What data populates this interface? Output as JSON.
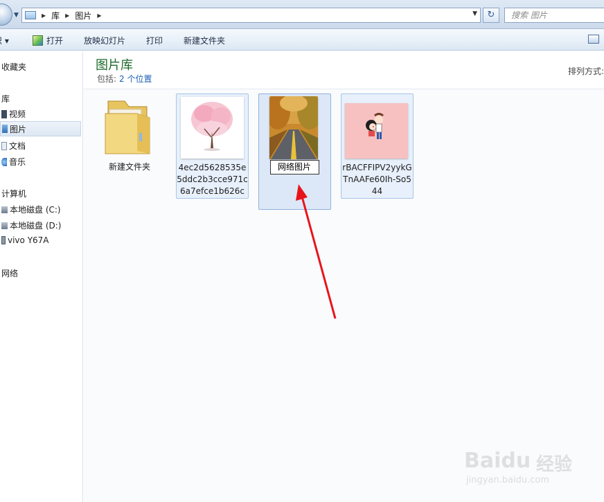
{
  "address": {
    "breadcrumbs": [
      "库",
      "图片"
    ],
    "search_placeholder": "搜索 图片"
  },
  "toolbar": {
    "organize_label": "织 ▾",
    "open_label": "打开",
    "slideshow_label": "放映幻灯片",
    "print_label": "打印",
    "new_folder_label": "新建文件夹"
  },
  "nav": {
    "favorites": "收藏夹",
    "libraries": "库",
    "items": [
      {
        "label": "视频",
        "icon": "video-icon"
      },
      {
        "label": "图片",
        "icon": "pictures-icon",
        "selected": true
      },
      {
        "label": "文档",
        "icon": "document-icon"
      },
      {
        "label": "音乐",
        "icon": "music-icon"
      }
    ],
    "computer": "计算机",
    "drives": [
      {
        "label": "本地磁盘 (C:)",
        "icon": "drive-icon"
      },
      {
        "label": "本地磁盘 (D:)",
        "icon": "drive-icon"
      },
      {
        "label": "vivo Y67A",
        "icon": "phone-icon"
      }
    ],
    "network": "网络"
  },
  "library": {
    "title": "图片库",
    "includes_label": "包括:",
    "locations_link": "2 个位置",
    "arrange_label": "排列方式:"
  },
  "files": [
    {
      "name": "新建文件夹",
      "type": "folder"
    },
    {
      "name": "4ec2d5628535e5ddc2b3cce971c6a7efce1b626c",
      "type": "image",
      "thumb": "cherry-blossom-tree"
    },
    {
      "name": "网络图片",
      "type": "image",
      "thumb": "autumn-road",
      "renaming": true
    },
    {
      "name": "rBACFFIPV2yykGTnAAFe60Ih-So544",
      "type": "image",
      "thumb": "cartoon-couple"
    }
  ],
  "watermark": {
    "brand": "Baidu",
    "suffix": "经验",
    "url": "jingyan.baidu.com"
  },
  "colors": {
    "library_title": "#1d6a2c",
    "link": "#1a5fb4",
    "selection_bg": "#dce8f7",
    "arrow": "#e8141b"
  }
}
